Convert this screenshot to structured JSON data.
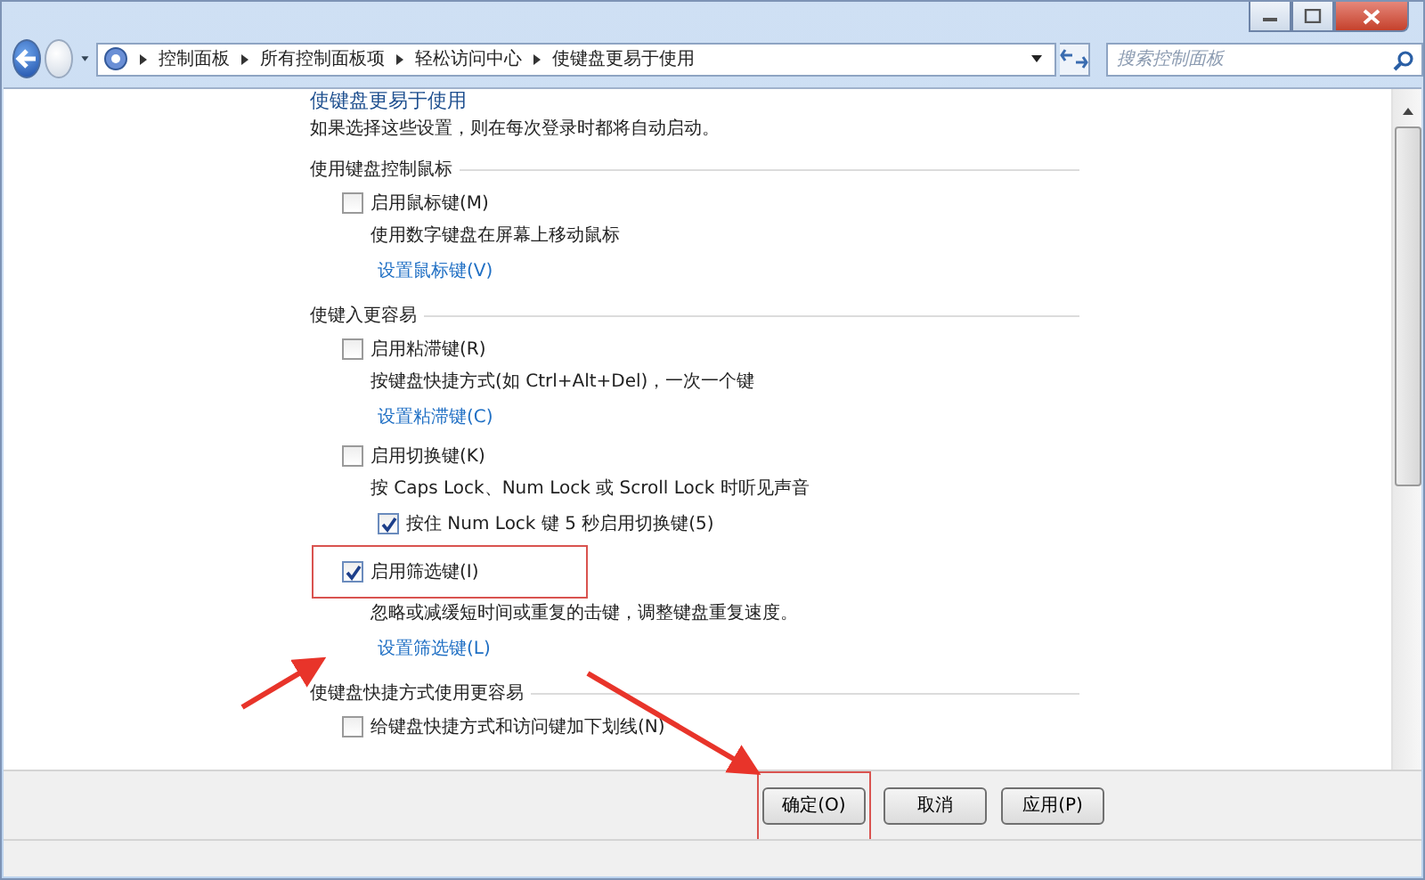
{
  "address_bar": {
    "breadcrumbs": [
      "控制面板",
      "所有控制面板项",
      "轻松访问中心",
      "使键盘更易于使用"
    ]
  },
  "search": {
    "placeholder": "搜索控制面板"
  },
  "page": {
    "heading": "使键盘更易于使用",
    "intro": "如果选择这些设置，则在每次登录时都将自动启动。"
  },
  "sections": [
    {
      "title": "使用键盘控制鼠标",
      "items": [
        {
          "label": "启用鼠标键(M)",
          "checked": false,
          "description": "使用数字键盘在屏幕上移动鼠标",
          "link": "设置鼠标键(V)",
          "highlighted": false
        }
      ]
    },
    {
      "title": "使键入更容易",
      "items": [
        {
          "label": "启用粘滞键(R)",
          "checked": false,
          "description": "按键盘快捷方式(如 Ctrl+Alt+Del)，一次一个键",
          "link": "设置粘滞键(C)",
          "highlighted": false
        },
        {
          "label": "启用切换键(K)",
          "checked": false,
          "description": "按 Caps Lock、Num Lock 或 Scroll Lock 时听见声音",
          "highlighted": false,
          "children": [
            {
              "label": "按住 Num Lock 键 5 秒启用切换键(5)",
              "checked": true
            }
          ]
        },
        {
          "label": "启用筛选键(I)",
          "checked": true,
          "description": "忽略或减缓短时间或重复的击键，调整键盘重复速度。",
          "link": "设置筛选键(L)",
          "highlighted": true
        }
      ]
    },
    {
      "title": "使键盘快捷方式使用更容易",
      "items": [
        {
          "label": "给键盘快捷方式和访问键加下划线(N)",
          "checked": false,
          "highlighted": false
        }
      ]
    }
  ],
  "buttons": [
    {
      "label": "确定(O)",
      "highlighted": true
    },
    {
      "label": "取消",
      "highlighted": false
    },
    {
      "label": "应用(P)",
      "highlighted": false
    }
  ]
}
